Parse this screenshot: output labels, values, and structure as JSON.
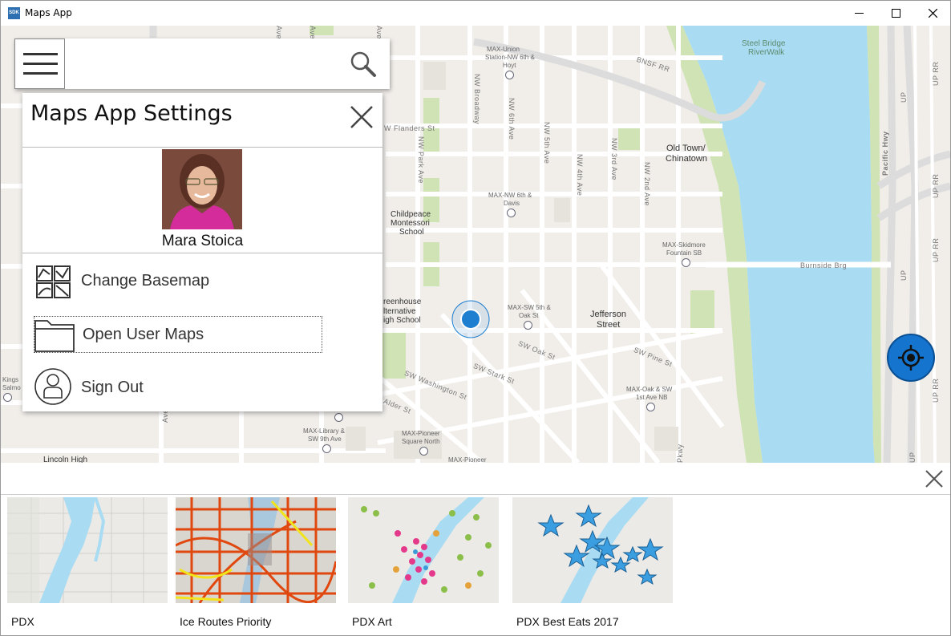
{
  "window": {
    "title": "Maps App",
    "app_icon_text": "SDK",
    "controls": {
      "minimize": "minimize-icon",
      "maximize": "maximize-icon",
      "close": "close-icon"
    }
  },
  "search": {
    "menu_icon": "hamburger-icon",
    "search_icon": "search-icon"
  },
  "settings": {
    "title": "Maps App Settings",
    "close_icon": "close-icon",
    "user_name": "Mara Stoica",
    "items": [
      {
        "label": "Change Basemap",
        "icon": "basemap-grid-icon"
      },
      {
        "label": "Open User Maps",
        "icon": "folder-icon"
      },
      {
        "label": "Sign Out",
        "icon": "user-icon"
      }
    ]
  },
  "map": {
    "labels": {
      "steel_bridge_1": "Steel Bridge",
      "steel_bridge_2": "RiverWalk",
      "bnsf": "BNSF RR",
      "union_1": "MAX-Union",
      "union_2": "Station-NW 6th &",
      "union_3": "Hoyt",
      "nw_broadway": "NW Broadway",
      "nw_6th": "NW 6th Ave",
      "nw_5th": "NW 5th Ave",
      "nw_4th": "NW 4th Ave",
      "nw_3rd": "NW 3rd Ave",
      "nw_2nd": "NW 2nd Ave",
      "nw_park": "NW Park Ave",
      "flanders": "W Flanders St",
      "oldtown_1": "Old Town/",
      "oldtown_2": "Chinatown",
      "pacific": "Pacific Hwy",
      "davis_1": "MAX-NW 6th &",
      "davis_2": "Davis",
      "childpeace_1": "Childpeace",
      "childpeace_2": "Montessori",
      "childpeace_3": "School",
      "skidmore_1": "MAX-Skidmore",
      "skidmore_2": "Fountain SB",
      "burnside": "Burnside Brg",
      "greenhouse_1": "reenhouse",
      "greenhouse_2": "lternative",
      "greenhouse_3": "igh School",
      "oak_max_1": "MAX-SW 5th &",
      "oak_max_2": "Oak St",
      "jefferson_1": "Jefferson",
      "jefferson_2": "Street",
      "sw_oak": "SW Oak St",
      "sw_pine": "SW Pine St",
      "sw_stark": "SW Stark St",
      "sw_washington": "SW Washington St",
      "oak1st_1": "MAX-Oak & SW",
      "oak1st_2": "1st Ave NB",
      "kings_1": "Kings",
      "kings_2": "Salmo",
      "alder": "Alder St",
      "library_1": "MAX-Library &",
      "library_2": "SW 9th Ave",
      "pioneer_1": "MAX-Pioneer",
      "pioneer_2": "Square North",
      "pioneer_3": "MAX-Pioneer",
      "lincoln": "Lincoln High",
      "pkwy": "Pkwy",
      "up1": "UP",
      "up2": "UP",
      "up3": "UP",
      "up4": "UP",
      "rr1": "UP RR",
      "rr2": "UP RR",
      "rr3": "UP RR",
      "rr4": "UP RR",
      "ave1": "Ave",
      "ave2": "Ave",
      "ave3": "Ave",
      "ave4": "Ave"
    },
    "locate_icon": "locate-crosshair-icon",
    "location_marker": "current-location-dot"
  },
  "maps_gallery": {
    "close_icon": "close-icon",
    "items": [
      {
        "title": "PDX"
      },
      {
        "title": "Ice Routes Priority"
      },
      {
        "title": "PDX Art"
      },
      {
        "title": "PDX Best Eats 2017"
      }
    ]
  },
  "colors": {
    "water": "#a9dcf2",
    "park": "#cfe3b4",
    "map_bg": "#f1eeea",
    "accent_blue": "#1474ce",
    "marker_blue": "#1e7fd0"
  }
}
